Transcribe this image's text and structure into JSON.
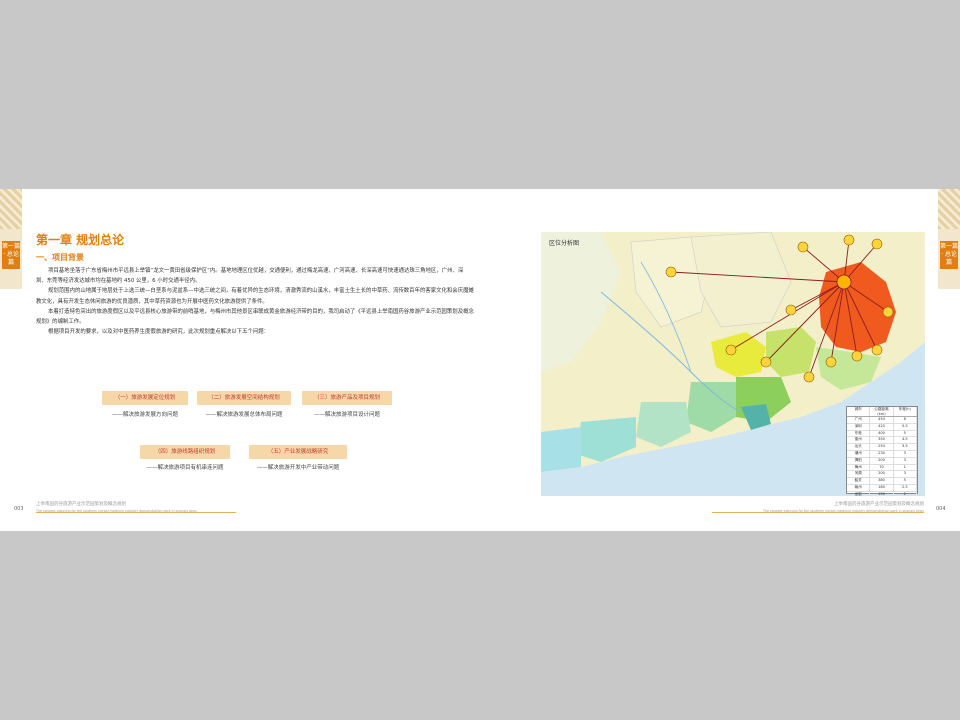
{
  "left_page": {
    "side_tab": "第一篇 · 总论篇",
    "chapter_title": "第一章  规划总论",
    "section_title": "一、项目背景",
    "paragraphs": [
      "项目基地坐落于广东省梅州市平远县上举镇“龙文一黄田省级保护区”内。基地地理区位优越，交通便利，通过梅龙高速、广河高速、长深高速可快速通达珠三角地区，广州、深圳、东莞等经济发达城市均在基地约 450 公里，6 小时交通半径内。",
      "规划范围内的山地属于地层处于上选三统—白垩系与泥盆系—中选三统之间，有着优异的生态环境，清澈秀流的山溪水，丰富土生土长的中草药、流传数百年的客家文化和会庆魔傩教文化，具有开发生态休闲旅游的优良潜质，其中草药资源也为开展中医药文化旅游提供了条件。",
      "本着打造特色突出的旅游度假区以及平远县核心旅游带的前哨基地，与梅州市其他景区串联成黄金旅游经济带的目的，我司启动了《平远县上举南国药谷旅游产业示范园策划及概念规划》的编制工作。",
      "根据项目开发的要求，以及对中医药养生度假旅游的研究，此次规划重点解决以下五个问题："
    ],
    "topics": [
      {
        "label": "（一）旅游发展定位规划",
        "answer": "——解决旅游发展方向问题"
      },
      {
        "label": "（二）旅游发展空间结构规划",
        "answer": "——解决旅游发展总体布局问题"
      },
      {
        "label": "（三）旅游产品及项目规划",
        "answer": "——解决旅游项目设计问题"
      },
      {
        "label": "（四）旅游线路组织规划",
        "answer": "——解决旅游项目有机串连问题"
      },
      {
        "label": "（五）产业发展战略研究",
        "answer": "——解决旅游开发中产业带动问题"
      }
    ],
    "page_number": "003",
    "footer_title": "上举南国药谷旅游产业示范园策划及概念规划",
    "footer_subtitle": "The concept planning for the southern herbal medicine industry demonstration park in shangju town"
  },
  "right_page": {
    "side_tab": "第一篇 · 总论篇",
    "map_title": "区位分析图",
    "table_headers": [
      "城市",
      "公路距离(km)",
      "车程(h)"
    ],
    "table_rows": [
      [
        "广州",
        "450",
        "6"
      ],
      [
        "深圳",
        "420",
        "5.5"
      ],
      [
        "东莞",
        "400",
        "5"
      ],
      [
        "惠州",
        "350",
        "4.5"
      ],
      [
        "汕头",
        "250",
        "3.5"
      ],
      [
        "潮州",
        "230",
        "3"
      ],
      [
        "揭阳",
        "200",
        "3"
      ],
      [
        "梅州",
        "70",
        "1"
      ],
      [
        "河源",
        "200",
        "3"
      ],
      [
        "韶关",
        "380",
        "5"
      ],
      [
        "赣州",
        "180",
        "2.5"
      ],
      [
        "龙岩",
        "150",
        "2"
      ],
      [
        "漳州",
        "250",
        "3.5"
      ]
    ],
    "page_number": "004",
    "footer_title": "上举南国药谷旅游产业示范园策划及概念规划",
    "footer_subtitle": "The concept planning for the southern herbal medicine industry demonstration park in shangju town"
  },
  "colors": {
    "accent": "#e07f10",
    "pill_bg": "#f6d8a8",
    "pill_text": "#c0392b",
    "meizhou_region": "#f05a1e",
    "sea": "#cfe6f2"
  }
}
